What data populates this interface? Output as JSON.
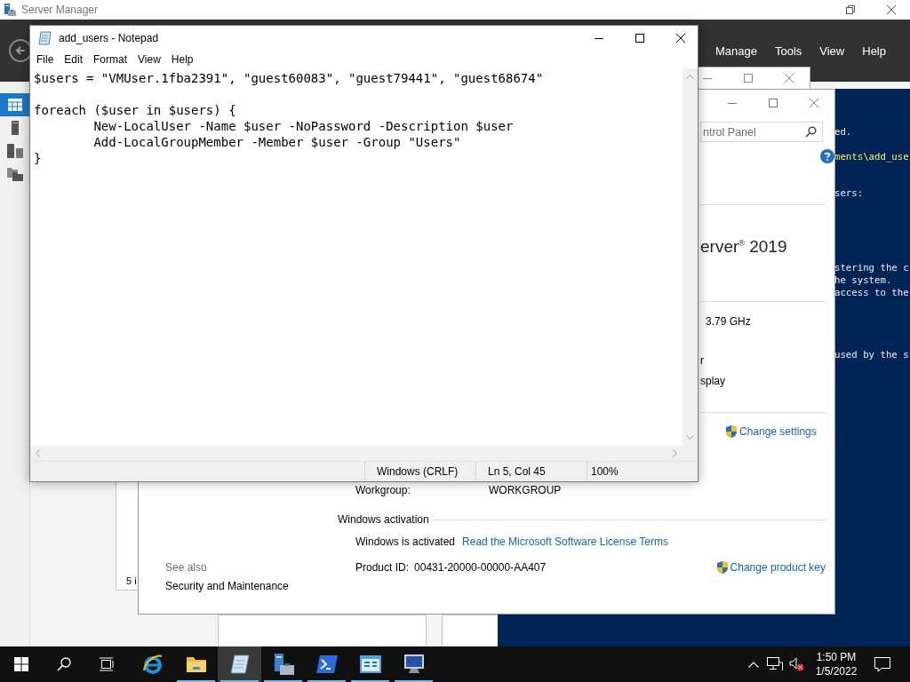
{
  "server_manager": {
    "title": "Server Manager",
    "menu": [
      "Manage",
      "Tools",
      "View",
      "Help"
    ],
    "nav": [
      {
        "selected": true
      },
      {
        "selected": false
      },
      {
        "selected": false
      },
      {
        "selected": false
      }
    ],
    "tile_text": "5 i"
  },
  "powershell": {
    "lines": [
      {
        "text": "ed.",
        "kind": "output"
      },
      {
        "text": "ments\\add_use",
        "kind": "command"
      },
      {
        "text": "sers:",
        "kind": "output"
      },
      {
        "text": "stering the c",
        "kind": "output"
      },
      {
        "text": "he system.",
        "kind": "output"
      },
      {
        "text": "access to the",
        "kind": "output"
      },
      {
        "text": "used by the s",
        "kind": "output"
      }
    ]
  },
  "system": {
    "search": {
      "placeholder": "ntrol Panel"
    },
    "edition": "erver$^{®}$ 2019",
    "processor_speed": "3.79 GHz",
    "row_1": "r",
    "row_2": "splay",
    "change_settings": "Change settings",
    "workgroup": {
      "label": "Workgroup:",
      "value": "WORKGROUP"
    },
    "activation": {
      "heading": "Windows activation",
      "status": "Windows is activated",
      "license_link": "Read the Microsoft Software License Terms",
      "product_id_label": "Product ID:",
      "product_id": "00431-20000-00000-AA407",
      "change_key": "Change product key"
    },
    "see_also": {
      "heading": "See also",
      "links": [
        "Security and Maintenance"
      ]
    }
  },
  "notepad": {
    "title": "add_users - Notepad",
    "menu": [
      "File",
      "Edit",
      "Format",
      "View",
      "Help"
    ],
    "content": "$users = \"VMUser.1fba2391\", \"guest60083\", \"guest79441\", \"guest68674\"\n\nforeach ($user in $users) {\n\tNew-LocalUser -Name $user -NoPassword -Description $user\n\tAdd-LocalGroupMember -Member $user -Group \"Users\"\n}",
    "status": {
      "line_ending": "Windows (CRLF)",
      "position": "Ln 5, Col 45",
      "zoom": "100%"
    }
  },
  "taskbar": {
    "apps": [
      {
        "kind": "browser",
        "running": false,
        "selected": false
      },
      {
        "kind": "folder",
        "running": true,
        "selected": false
      },
      {
        "kind": "notepad",
        "running": true,
        "selected": true
      },
      {
        "kind": "server",
        "running": true,
        "selected": false
      },
      {
        "kind": "terminal",
        "running": true,
        "selected": false
      },
      {
        "kind": "control",
        "running": true,
        "selected": false
      },
      {
        "kind": "remote",
        "running": true,
        "selected": false
      }
    ],
    "time": "1:50 PM",
    "date": "1/5/2022"
  }
}
